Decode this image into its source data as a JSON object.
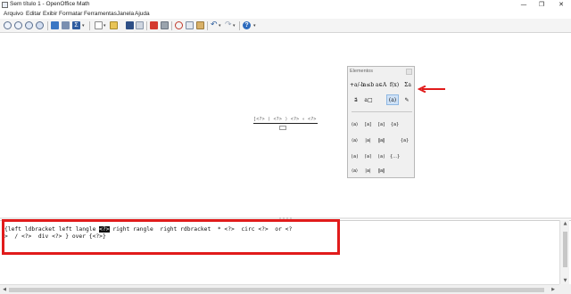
{
  "window": {
    "title": "Sem título 1 - OpenOffice Math",
    "minimize": "—",
    "maximize": "❐",
    "close": "✕"
  },
  "menu": [
    "Arquivo",
    "Editar",
    "Exibir",
    "Formatar",
    "Ferramentas",
    "Janela",
    "Ajuda"
  ],
  "toolbar": {
    "icons": [
      "zoom-in-icon",
      "zoom-out-icon",
      "zoom-100-icon",
      "show-all-icon",
      "update-icon",
      "formula-cursor-icon",
      "symbols-icon",
      "new-icon",
      "open-icon",
      "save-icon",
      "export-pdf-icon",
      "print-icon",
      "cut-icon",
      "copy-icon",
      "paste-icon",
      "undo-icon",
      "redo-icon",
      "help-icon"
    ]
  },
  "formula": {
    "numerator": "[<?> ⟨ <?> ⟩ <?> ∘ <?> ∨ <?> / <?> ÷ <?>]",
    "denominator_placeholder": "<?>"
  },
  "elements_panel": {
    "title": "Elementos",
    "categories": [
      {
        "label": "+a/-b",
        "name": "unary-binary-operators"
      },
      {
        "label": "a≤b",
        "name": "relations"
      },
      {
        "label": "a∈A",
        "name": "set-operations"
      },
      {
        "label": "f(x)",
        "name": "functions"
      },
      {
        "label": "Σa",
        "name": "operators"
      },
      {
        "label": "a⃗",
        "name": "attributes"
      },
      {
        "label": "a□",
        "name": "format"
      },
      {
        "label": "(a)",
        "name": "brackets"
      },
      {
        "label": "✎",
        "name": "others"
      }
    ],
    "selected_category": "brackets",
    "bracket_symbols": [
      [
        "(a)",
        "[a]",
        "⟦a⟧",
        "{a}"
      ],
      [
        "⟨a⟩",
        "|a|",
        "‖a‖",
        "⟨a|b⟩"
      ],
      [
        "⌊a⌋",
        "⌈a⌉",
        "⌊a⌋",
        "{...}"
      ],
      [
        "(a)",
        "[a]",
        "⟦a⟧",
        "{a}"
      ],
      [
        "⟨a⟩",
        "|a|",
        "‖a‖"
      ]
    ]
  },
  "editor": {
    "line1_before": "{left ldbracket left langle ",
    "line1_selected": "<?>",
    "line1_after": " right rangle  right rdbracket  * <?>  circ <?>  or <?",
    "line2": ">  / <?>  div <?> } over {<?>}"
  },
  "colors": {
    "annotation_red": "#e11b1b",
    "selection_bg": "#111111",
    "panel_bg": "#f0f0f0"
  }
}
